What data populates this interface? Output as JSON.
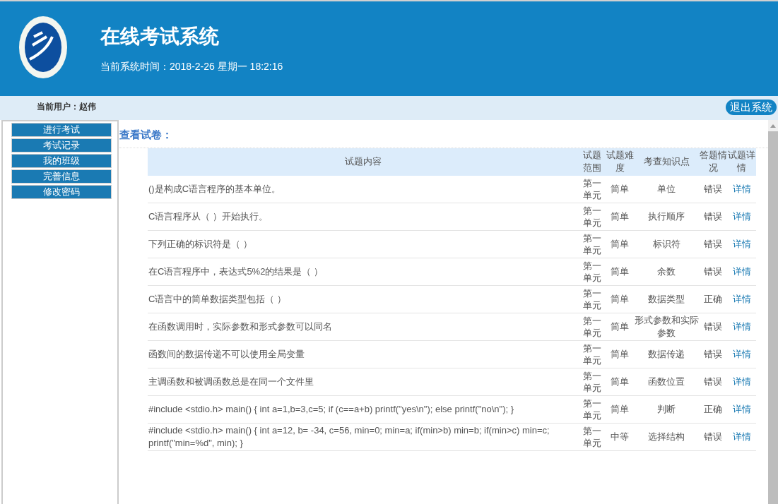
{
  "header": {
    "title": "在线考试系统",
    "time": "当前系统时间：2018-2-26 星期一 18:2:16"
  },
  "user_bar": {
    "user": "当前用户：赵伟",
    "logout": "退出系统"
  },
  "sidebar": {
    "items": [
      {
        "label": "进行考试"
      },
      {
        "label": "考试记录"
      },
      {
        "label": "我的班级"
      },
      {
        "label": "完善信息"
      },
      {
        "label": "修改密码"
      }
    ]
  },
  "section_title": "查看试卷：",
  "table": {
    "columns": [
      "试题内容",
      "试题范围",
      "试题难度",
      "考查知识点",
      "答题情况",
      "试题详情"
    ],
    "rows": [
      {
        "content": "()是构成C语言程序的基本单位。",
        "range": "第一单元",
        "difficulty": "简单",
        "topic": "单位",
        "result": "错误",
        "detail": "详情"
      },
      {
        "content": "C语言程序从（ ）开始执行。",
        "range": "第一单元",
        "difficulty": "简单",
        "topic": "执行顺序",
        "result": "错误",
        "detail": "详情"
      },
      {
        "content": "下列正确的标识符是（ ）",
        "range": "第一单元",
        "difficulty": "简单",
        "topic": "标识符",
        "result": "错误",
        "detail": "详情"
      },
      {
        "content": "在C语言程序中，表达式5%2的结果是（ ）",
        "range": "第一单元",
        "difficulty": "简单",
        "topic": "余数",
        "result": "错误",
        "detail": "详情"
      },
      {
        "content": "C语言中的简单数据类型包括（ ）",
        "range": "第一单元",
        "difficulty": "简单",
        "topic": "数据类型",
        "result": "正确",
        "detail": "详情"
      },
      {
        "content": "在函数调用时，实际参数和形式参数可以同名",
        "range": "第一单元",
        "difficulty": "简单",
        "topic": "形式参数和实际参数",
        "result": "错误",
        "detail": "详情"
      },
      {
        "content": "函数间的数据传递不可以使用全局变量",
        "range": "第一单元",
        "difficulty": "简单",
        "topic": "数据传递",
        "result": "错误",
        "detail": "详情"
      },
      {
        "content": "主调函数和被调函数总是在同一个文件里",
        "range": "第一单元",
        "difficulty": "简单",
        "topic": "函数位置",
        "result": "错误",
        "detail": "详情"
      },
      {
        "content": "#include <stdio.h> main() { int a=1,b=3,c=5; if (c==a+b) printf(\"yes\\n\"); else printf(\"no\\n\"); }",
        "range": "第一单元",
        "difficulty": "简单",
        "topic": "判断",
        "result": "正确",
        "detail": "详情"
      },
      {
        "content": "#include <stdio.h> main() { int a=12, b= -34, c=56, min=0; min=a; if(min>b) min=b; if(min>c) min=c; printf(\"min=%d\", min); }",
        "range": "第一单元",
        "difficulty": "中等",
        "topic": "选择结构",
        "result": "错误",
        "detail": "详情"
      }
    ]
  }
}
